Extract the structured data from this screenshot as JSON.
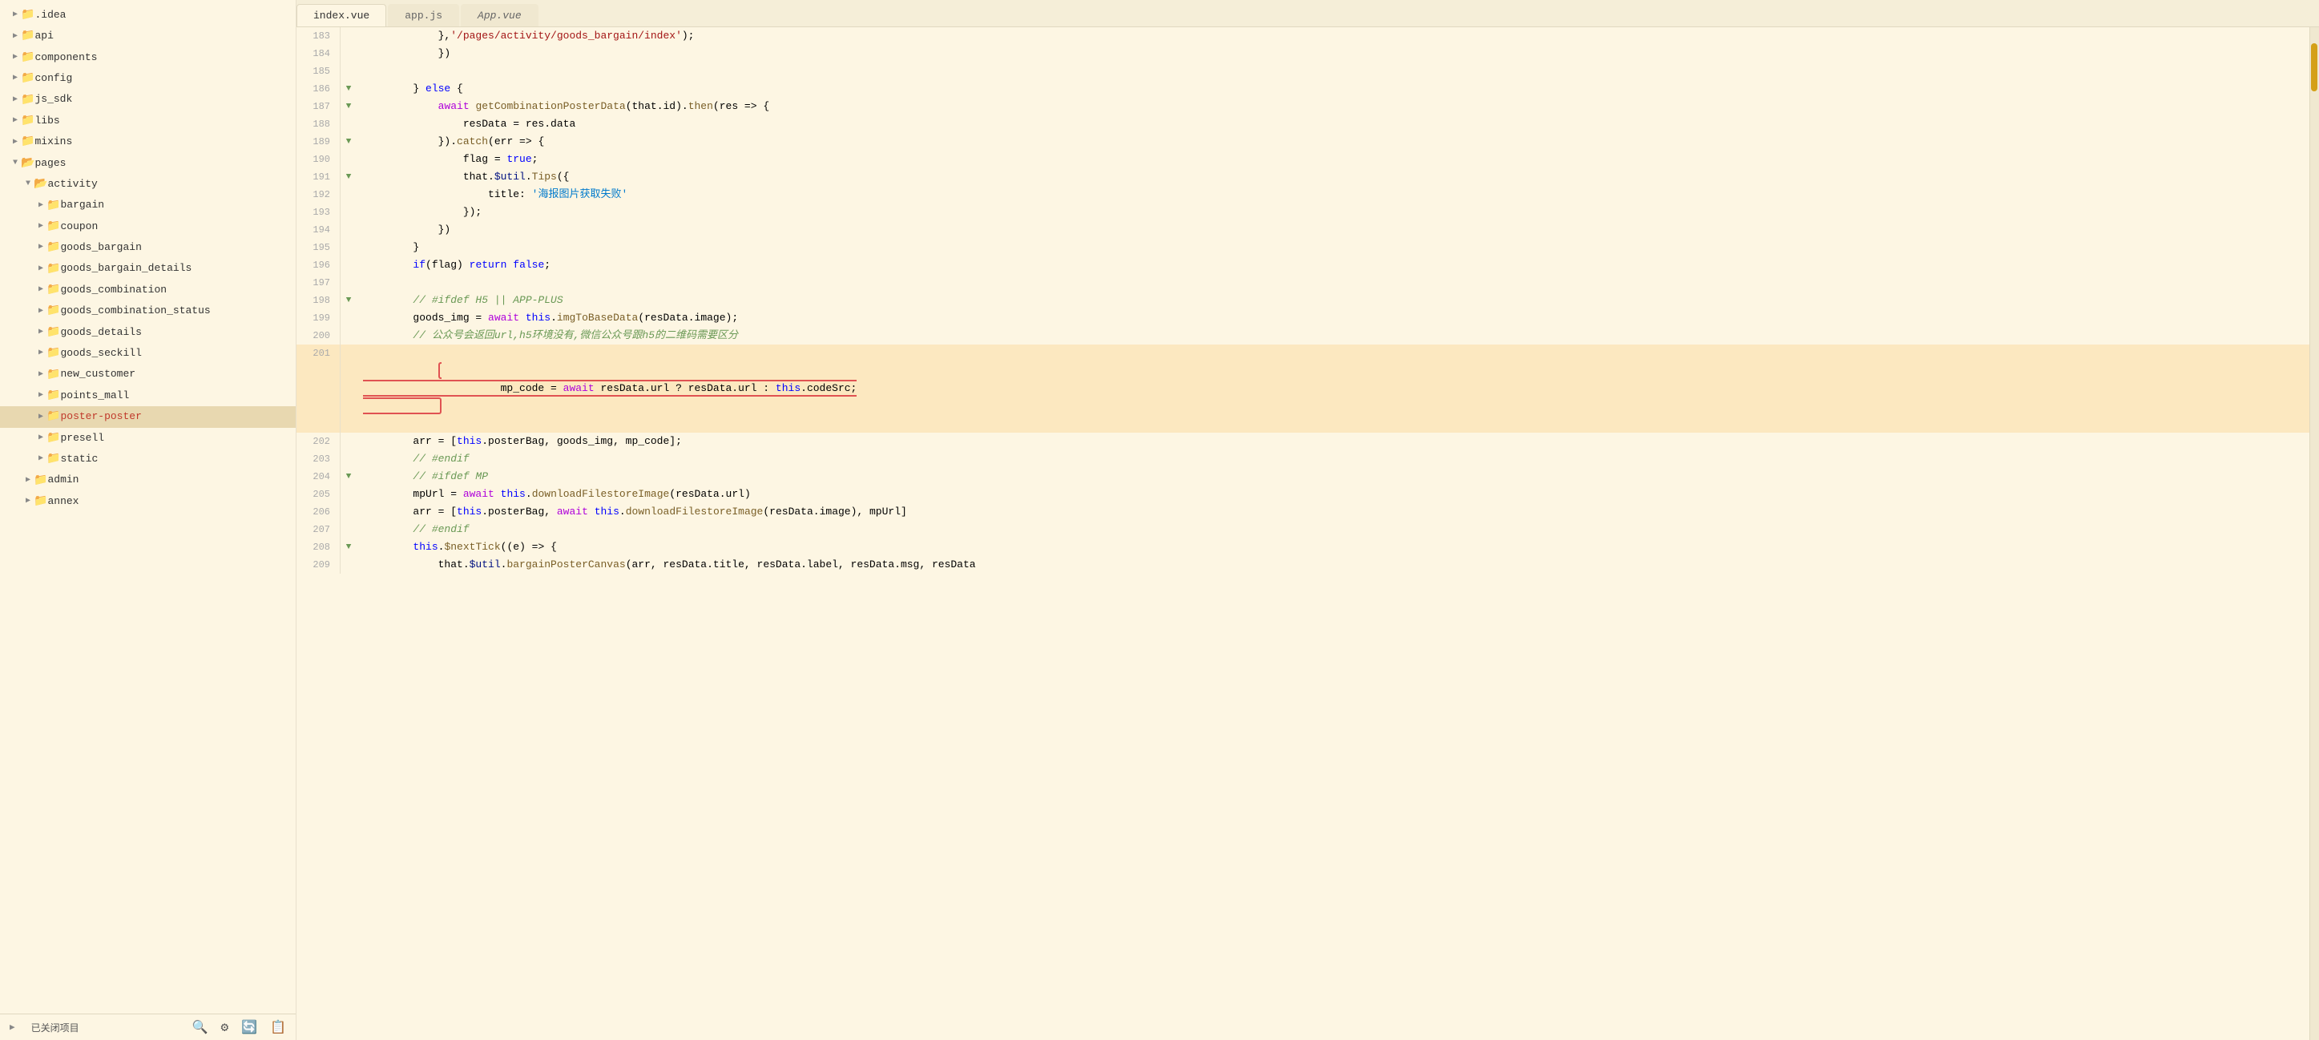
{
  "sidebar": {
    "close_project_label": "已关闭项目",
    "items": [
      {
        "label": ".idea",
        "type": "folder",
        "indent": 1,
        "expanded": false
      },
      {
        "label": "api",
        "type": "folder",
        "indent": 1,
        "expanded": false
      },
      {
        "label": "components",
        "type": "folder",
        "indent": 1,
        "expanded": false
      },
      {
        "label": "config",
        "type": "folder",
        "indent": 1,
        "expanded": false
      },
      {
        "label": "js_sdk",
        "type": "folder",
        "indent": 1,
        "expanded": false
      },
      {
        "label": "libs",
        "type": "folder",
        "indent": 1,
        "expanded": false
      },
      {
        "label": "mixins",
        "type": "folder",
        "indent": 1,
        "expanded": false
      },
      {
        "label": "pages",
        "type": "folder",
        "indent": 1,
        "expanded": true
      },
      {
        "label": "activity",
        "type": "folder",
        "indent": 2,
        "expanded": true
      },
      {
        "label": "bargain",
        "type": "folder",
        "indent": 3,
        "expanded": false
      },
      {
        "label": "coupon",
        "type": "folder",
        "indent": 3,
        "expanded": false
      },
      {
        "label": "goods_bargain",
        "type": "folder",
        "indent": 3,
        "expanded": false
      },
      {
        "label": "goods_bargain_details",
        "type": "folder",
        "indent": 3,
        "expanded": false
      },
      {
        "label": "goods_combination",
        "type": "folder",
        "indent": 3,
        "expanded": false
      },
      {
        "label": "goods_combination_status",
        "type": "folder",
        "indent": 3,
        "expanded": false
      },
      {
        "label": "goods_details",
        "type": "folder",
        "indent": 3,
        "expanded": false
      },
      {
        "label": "goods_seckill",
        "type": "folder",
        "indent": 3,
        "expanded": false
      },
      {
        "label": "new_customer",
        "type": "folder",
        "indent": 3,
        "expanded": false
      },
      {
        "label": "points_mall",
        "type": "folder",
        "indent": 3,
        "expanded": false
      },
      {
        "label": "poster-poster",
        "type": "folder",
        "indent": 3,
        "expanded": false,
        "selected": true
      },
      {
        "label": "presell",
        "type": "folder",
        "indent": 3,
        "expanded": false
      },
      {
        "label": "static",
        "type": "folder",
        "indent": 3,
        "expanded": false
      },
      {
        "label": "admin",
        "type": "folder",
        "indent": 2,
        "expanded": false
      },
      {
        "label": "annex",
        "type": "folder",
        "indent": 2,
        "expanded": false
      }
    ]
  },
  "tabs": [
    {
      "label": "index.vue",
      "active": true
    },
    {
      "label": "app.js",
      "active": false
    },
    {
      "label": "App.vue",
      "active": false,
      "italic": true
    }
  ],
  "code": {
    "lines": [
      {
        "num": 183,
        "gutter": "",
        "content": "                },'/pages/activity/goods_bargain/index');",
        "type": "plain"
      },
      {
        "num": 184,
        "gutter": "",
        "content": "            })",
        "type": "plain"
      },
      {
        "num": 185,
        "gutter": "",
        "content": "",
        "type": "plain"
      },
      {
        "num": 186,
        "gutter": "▼",
        "content": "        } else {",
        "type": "plain"
      },
      {
        "num": 187,
        "gutter": "▼",
        "content": "            await getCombinationPosterData(that.id).then(res => {",
        "type": "plain"
      },
      {
        "num": 188,
        "gutter": "",
        "content": "                resData = res.data",
        "type": "plain"
      },
      {
        "num": 189,
        "gutter": "▼",
        "content": "            }).catch(err => {",
        "type": "plain"
      },
      {
        "num": 190,
        "gutter": "",
        "content": "                flag = true;",
        "type": "plain"
      },
      {
        "num": 191,
        "gutter": "▼",
        "content": "                that.$util.Tips({",
        "type": "plain"
      },
      {
        "num": 192,
        "gutter": "",
        "content": "                    title: '海报图片获取失败'",
        "type": "plain"
      },
      {
        "num": 193,
        "gutter": "",
        "content": "                });",
        "type": "plain"
      },
      {
        "num": 194,
        "gutter": "",
        "content": "            })",
        "type": "plain"
      },
      {
        "num": 195,
        "gutter": "",
        "content": "        }",
        "type": "plain"
      },
      {
        "num": 196,
        "gutter": "",
        "content": "        if(flag) return false;",
        "type": "plain"
      },
      {
        "num": 197,
        "gutter": "",
        "content": "",
        "type": "plain"
      },
      {
        "num": 198,
        "gutter": "▼",
        "content": "        // #ifdef H5 || APP-PLUS",
        "type": "comment"
      },
      {
        "num": 199,
        "gutter": "",
        "content": "        goods_img = await this.imgToBaseData(resData.image);",
        "type": "plain"
      },
      {
        "num": 200,
        "gutter": "",
        "content": "        // 公众号会返回url,h5环境没有,微信公众号跟h5的二维码需要区分",
        "type": "comment"
      },
      {
        "num": 201,
        "gutter": "",
        "content": "        mp_code = await resData.url ? resData.url : this.codeSrc;",
        "type": "highlight"
      },
      {
        "num": 202,
        "gutter": "",
        "content": "        arr = [this.posterBag, goods_img, mp_code];",
        "type": "plain"
      },
      {
        "num": 203,
        "gutter": "",
        "content": "        // #endif",
        "type": "comment"
      },
      {
        "num": 204,
        "gutter": "▼",
        "content": "        // #ifdef MP",
        "type": "comment"
      },
      {
        "num": 205,
        "gutter": "",
        "content": "        mpUrl = await this.downloadFilestoreImage(resData.url)",
        "type": "plain"
      },
      {
        "num": 206,
        "gutter": "",
        "content": "        arr = [this.posterBag, await this.downloadFilestoreImage(resData.image), mpUrl]",
        "type": "plain"
      },
      {
        "num": 207,
        "gutter": "",
        "content": "        // #endif",
        "type": "comment"
      },
      {
        "num": 208,
        "gutter": "▼",
        "content": "        this.$nextTick((e) => {",
        "type": "plain"
      },
      {
        "num": 209,
        "gutter": "",
        "content": "            that.$util.bargainPosterCanvas(arr, resData.title, resData.label, resData.msg, resData",
        "type": "plain"
      }
    ]
  }
}
